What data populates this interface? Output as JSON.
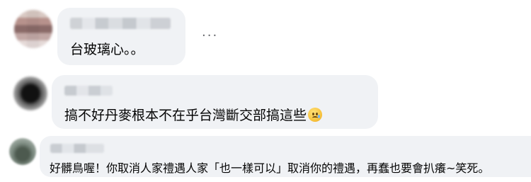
{
  "comments": [
    {
      "avatar_icon": "blurred-profile-avatar-icon",
      "text": "台玻璃心。。",
      "more_label": "···"
    },
    {
      "avatar_icon": "blurred-profile-avatar-icon",
      "text": "搞不好丹麥根本不在乎台灣斷交部搞這些",
      "emoji_icon": "sad-tear-face-icon"
    },
    {
      "avatar_icon": "blurred-profile-avatar-icon",
      "text": "好髒鳥喔！你取消人家禮遇人家「也一樣可以」取消你的禮遇，再蠢也要會扒癢~笑死。"
    }
  ],
  "colors": {
    "bubble_bg": "#f0f2f5",
    "text": "#050505",
    "secondary": "#65676b"
  }
}
